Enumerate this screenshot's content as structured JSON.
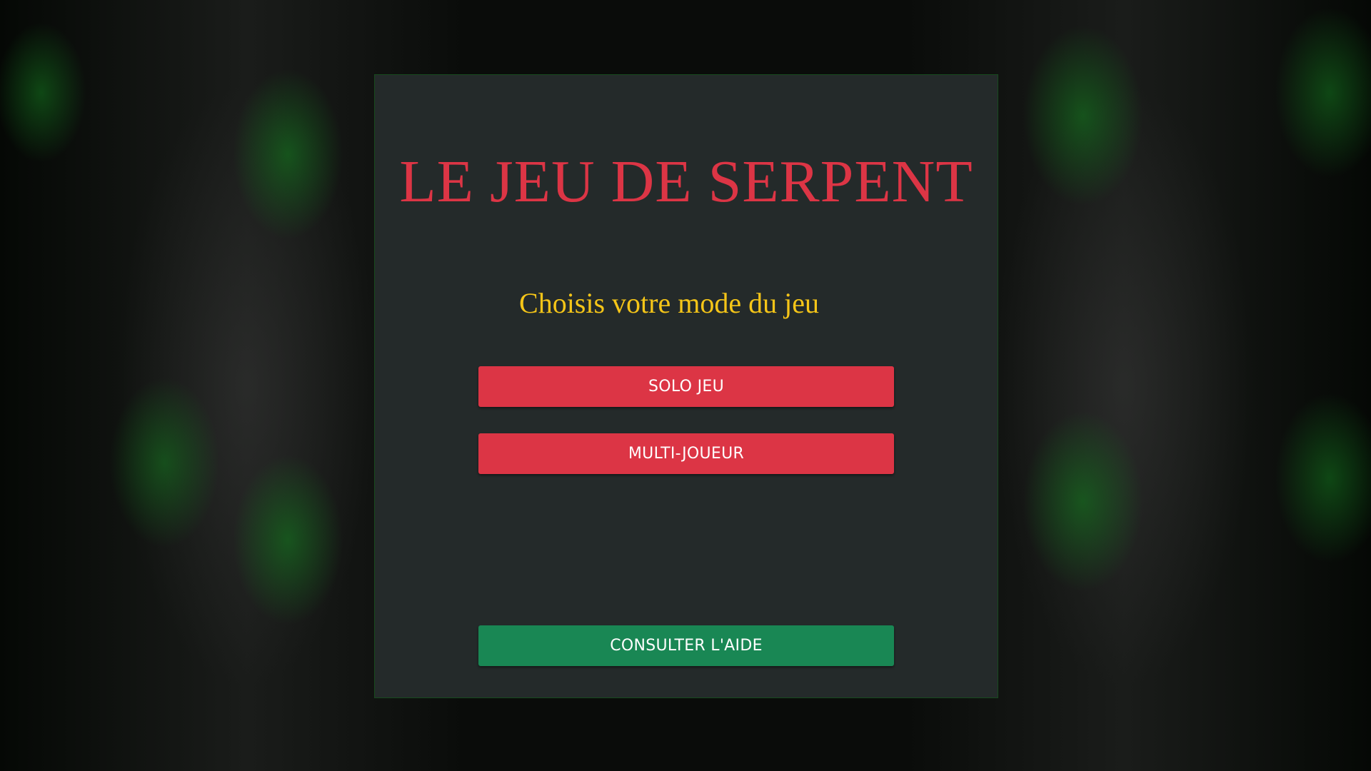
{
  "game": {
    "title": "LE JEU DE SERPENT",
    "subtitle": "Choisis votre mode du jeu"
  },
  "menu": {
    "solo_label": "SOLO JEU",
    "multi_label": "MULTI-JOUEUR",
    "help_label": "CONSULTER L'AIDE"
  },
  "colors": {
    "title": "#dc3545",
    "subtitle": "#f5c518",
    "primary_button": "#dc3545",
    "help_button": "#198754",
    "panel": "#242a2a"
  }
}
